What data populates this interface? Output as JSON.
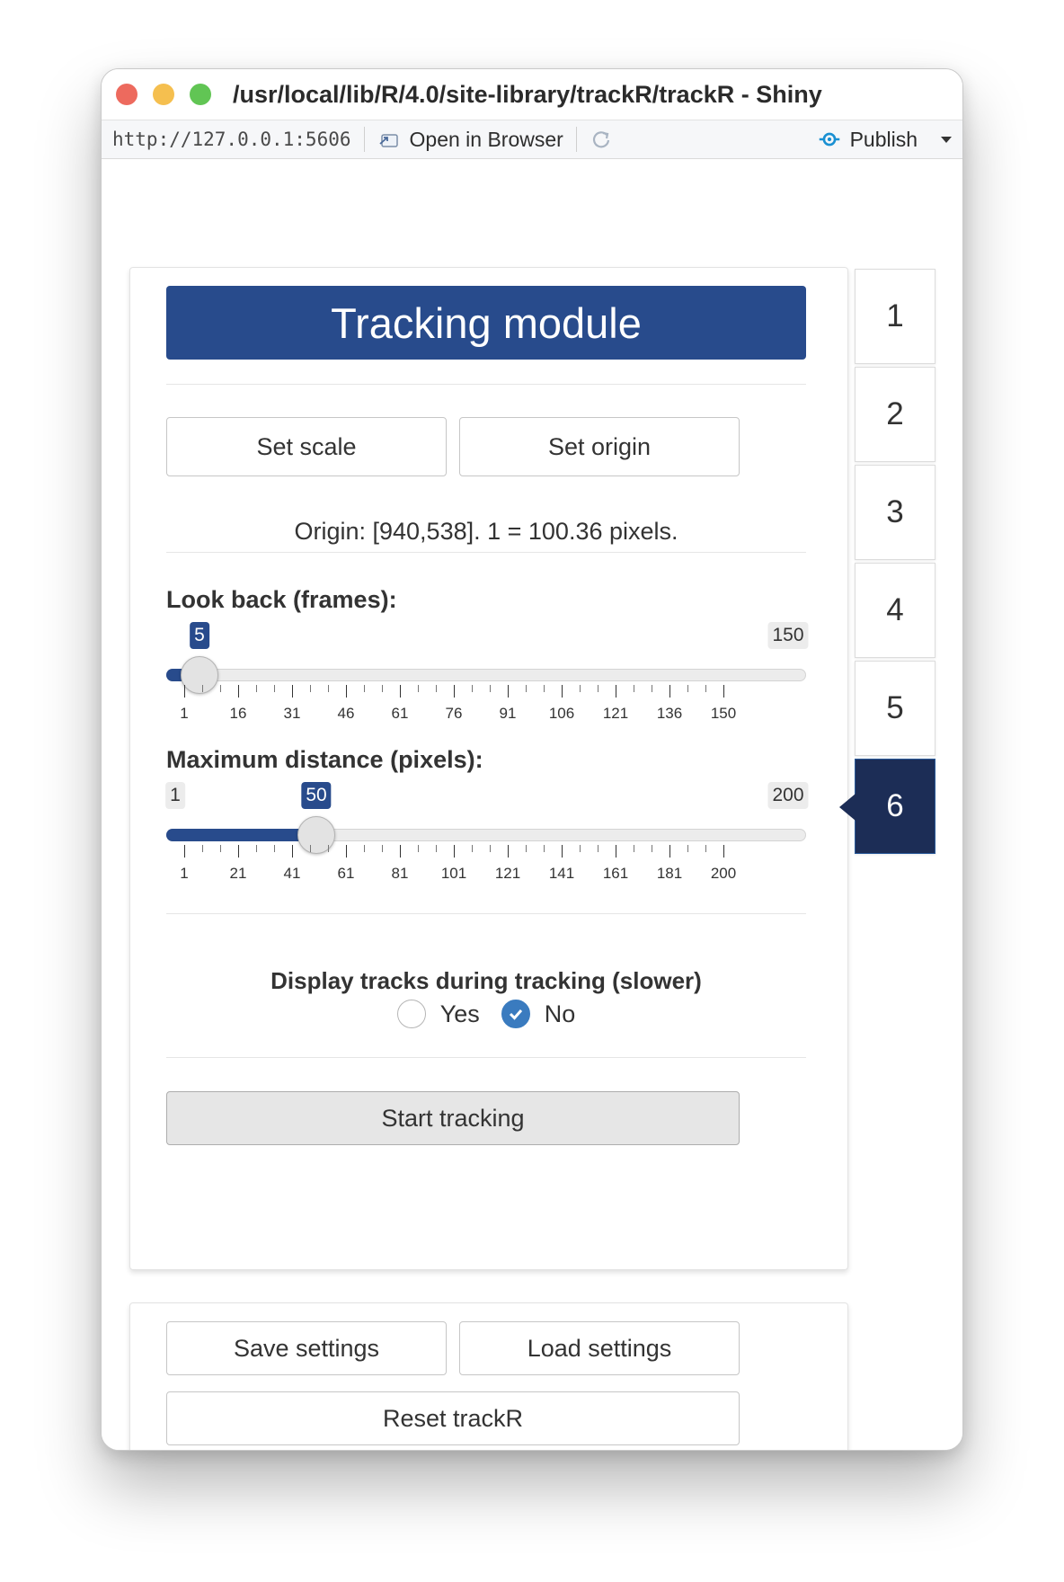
{
  "window": {
    "title": "/usr/local/lib/R/4.0/site-library/trackR/trackR - Shiny"
  },
  "toolbar": {
    "url": "http://127.0.0.1:5606",
    "open_in_browser": "Open in Browser",
    "publish": "Publish",
    "publish_icon": "publish-icon",
    "refresh_icon": "refresh-icon"
  },
  "module": {
    "title": "Tracking module",
    "set_scale": "Set scale",
    "set_origin": "Set origin",
    "origin_text": "Origin: [940,538]. 1 = 100.36 pixels.",
    "look_back": {
      "label": "Look back (frames):",
      "min": "1",
      "max": "150",
      "value": "5",
      "ticks": [
        "1",
        "16",
        "31",
        "46",
        "61",
        "76",
        "91",
        "106",
        "121",
        "136",
        "150"
      ]
    },
    "max_distance": {
      "label": "Maximum distance (pixels):",
      "min": "1",
      "max": "200",
      "value": "50",
      "ticks": [
        "1",
        "21",
        "41",
        "61",
        "81",
        "101",
        "121",
        "141",
        "161",
        "181",
        "200"
      ]
    },
    "display_tracks": {
      "label": "Display tracks during tracking (slower)",
      "options": [
        "Yes",
        "No"
      ],
      "selected": "No"
    },
    "start_tracking": "Start tracking"
  },
  "tabs": {
    "items": [
      "1",
      "2",
      "3",
      "4",
      "5",
      "6"
    ],
    "active": "6"
  },
  "settings": {
    "save": "Save settings",
    "load": "Load settings",
    "reset": "Reset trackR"
  },
  "colors": {
    "accent": "#284b8c",
    "active_tab": "#1c2d56",
    "radio_checked": "#3a7bbf"
  }
}
